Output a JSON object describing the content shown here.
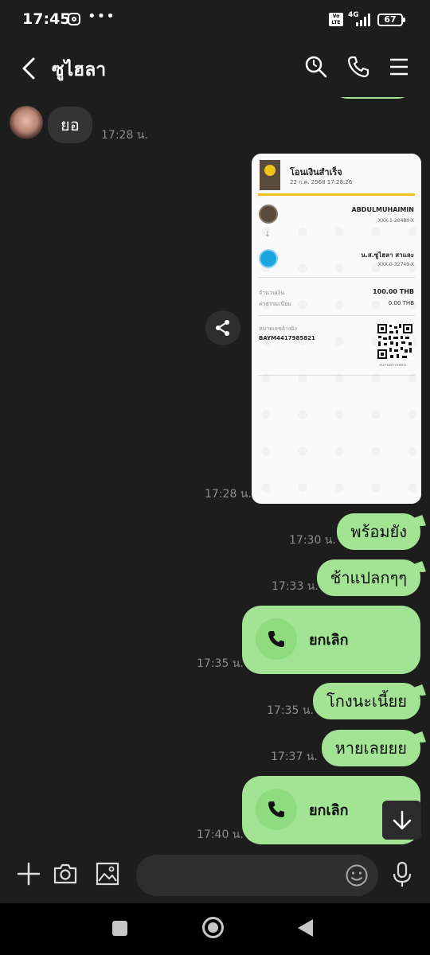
{
  "status_bar": {
    "time": "17:45",
    "volte": "Vo LTE",
    "network": "4G",
    "battery": "67"
  },
  "header": {
    "contact_name": "ซูไฮลา"
  },
  "messages": {
    "incoming": {
      "text": "ยอ",
      "time": "17:28 น."
    },
    "receipt": {
      "time": "17:28 น.",
      "title": "โอนเงินสำเร็จ",
      "date": "22 ก.ค. 2568 17:28:26",
      "sender_name": "ABDULMUHAIMIN",
      "sender_account": "XXX-1-20480-X",
      "receiver_name": "น.ส.ซูไฮลา สาและ",
      "receiver_account": "XXX-0-32749-X",
      "amount_label": "จำนวนเงิน",
      "amount": "100.00 THB",
      "fee_label": "ค่าธรรมเนียม",
      "fee": "0.00 THB",
      "ref_label": "หมายเลขอ้างอิง",
      "ref": "BAYM4417985821",
      "qr_label": "สแกนตรวจสอบ",
      "colors": {
        "krungsri_yellow": "#f0c419",
        "krungsri_brown": "#5a4a3c",
        "ktb_blue": "#1aa6e0"
      }
    },
    "outgoing": [
      {
        "text": "พร้อมยัง",
        "time": "17:30 น."
      },
      {
        "text": "ช้าแปลกๆๆ",
        "time": "17:33 น."
      },
      {
        "text": "โกงนะเนี้ยย",
        "time": "17:35 น."
      },
      {
        "text": "หายเลยยย",
        "time": "17:37 น."
      }
    ],
    "calls": [
      {
        "label": "ยกเลิก",
        "time": "17:35 น.",
        "icon": "phone-icon"
      },
      {
        "label": "ยกเลิก",
        "time": "17:40 น.",
        "icon": "phone-icon"
      }
    ]
  },
  "colors": {
    "background": "#1d1d1d",
    "outgoing_bubble": "#a2e494",
    "incoming_bubble": "#343434",
    "time_text": "#8d8d8d"
  }
}
